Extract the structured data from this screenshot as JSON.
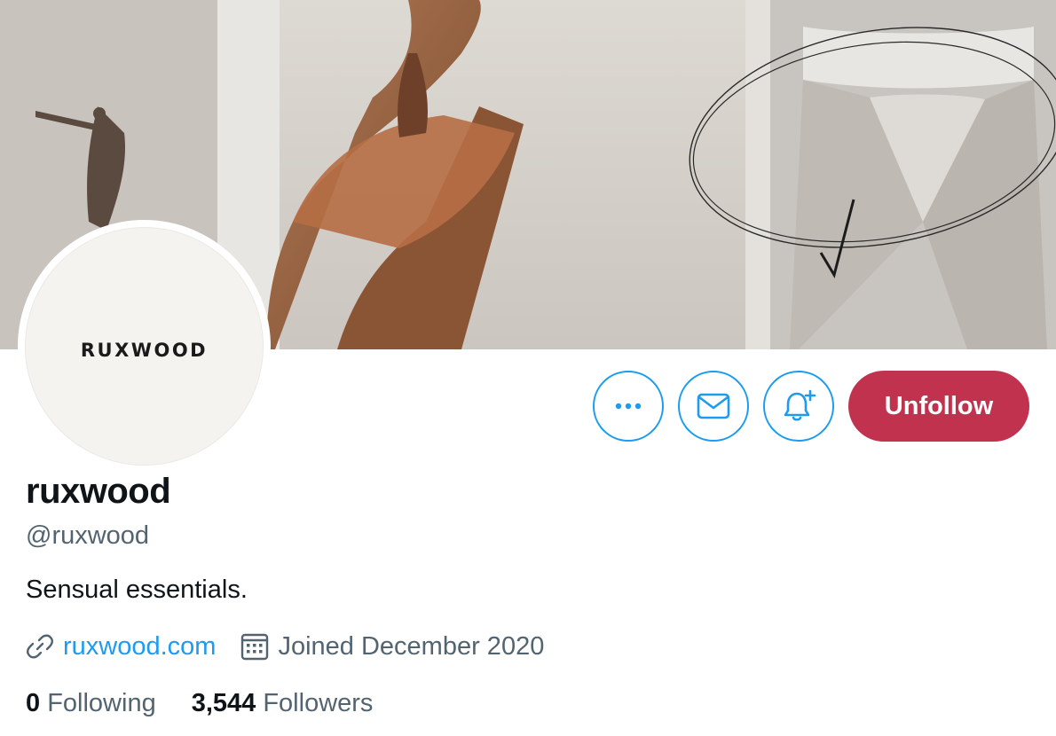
{
  "profile": {
    "display_name": "ruxwood",
    "handle": "@ruxwood",
    "bio": "Sensual essentials.",
    "avatar_logo": "RUXWOOD",
    "website": "ruxwood.com",
    "joined": "Joined December 2020"
  },
  "stats": {
    "following_count": "0",
    "following_label": "Following",
    "followers_count": "3,544",
    "followers_label": "Followers"
  },
  "actions": {
    "more_icon": "more-horizontal-icon",
    "message_icon": "envelope-icon",
    "notify_icon": "bell-plus-icon",
    "unfollow_label": "Unfollow"
  },
  "colors": {
    "accent": "#1d9bf0",
    "unfollow_bg": "#c0324d",
    "secondary_text": "#536471",
    "primary_text": "#0f1419"
  }
}
